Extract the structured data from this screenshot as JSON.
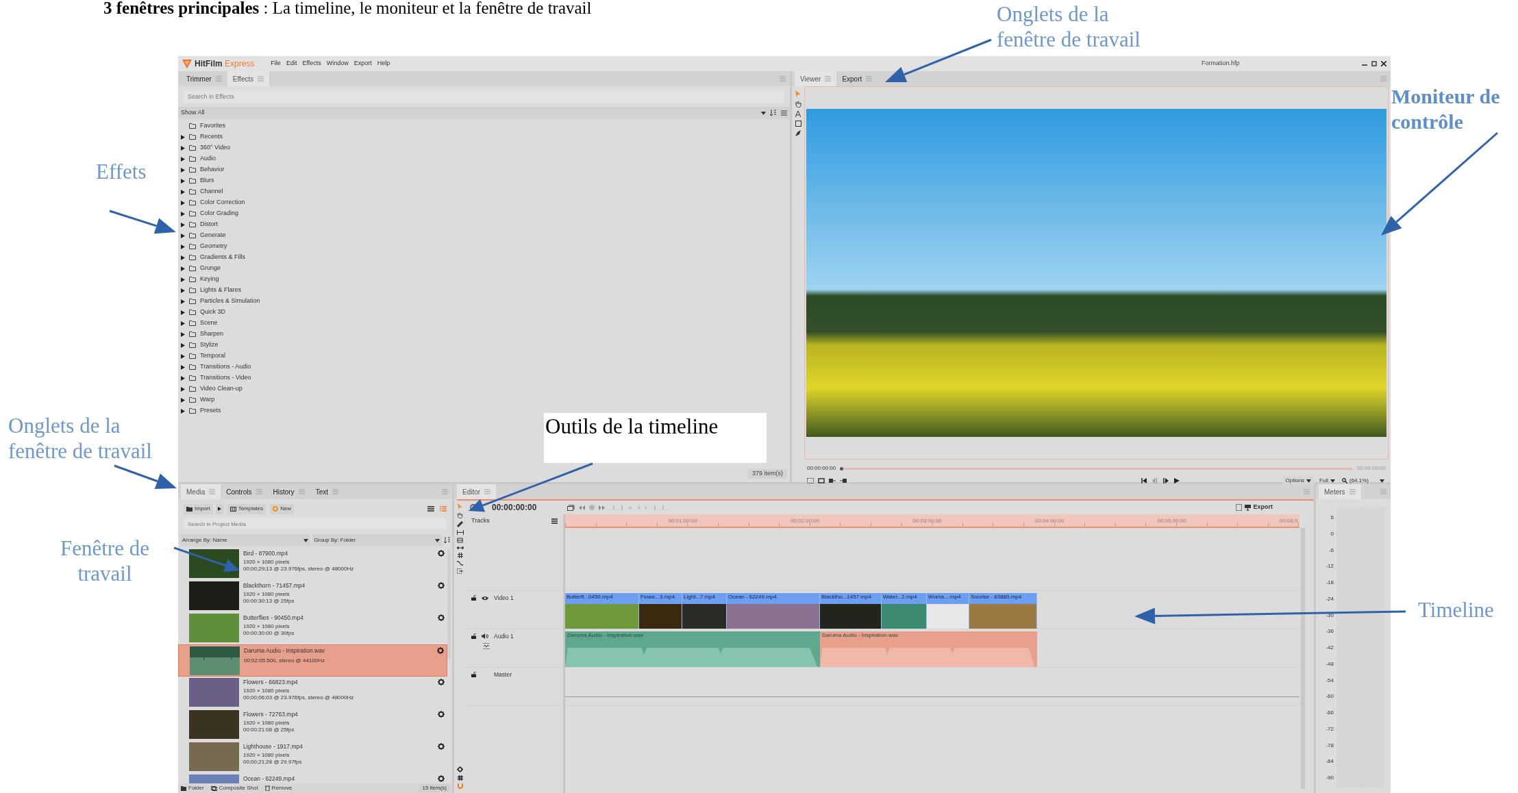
{
  "heading": "**3 fenêtres principales** : La timeline, le moniteur et la fenêtre de travail",
  "annotations": [
    {
      "kind": "plain",
      "text": "Onglets de la\nfenêtre de travail"
    },
    {
      "kind": "bold",
      "text": "Moniteur de\ncontrôle"
    },
    {
      "kind": "plain",
      "text": "Effets"
    },
    {
      "kind": "plain",
      "text": "Onglets de la\nfenêtre de travail"
    },
    {
      "kind": "boxed",
      "text": "Outils de la timeline"
    },
    {
      "kind": "plain",
      "text": "Fenêtre de\ntravail"
    },
    {
      "kind": "plain",
      "text": "Timeline"
    }
  ],
  "app": {
    "title_bar": {
      "app_name": "HitFilm",
      "edition": "Express",
      "menu": [
        "File",
        "Edit",
        "Effects",
        "Window",
        "Export",
        "Help"
      ],
      "project": "Formation.hfp"
    },
    "effects_panel": {
      "tabs": [
        {
          "label": "Trimmer",
          "selected": false
        },
        {
          "label": "Effects",
          "selected": true
        }
      ],
      "search": {
        "placeholder": "Search in Effects"
      },
      "filter": "Show All",
      "tree": [
        {
          "label": "Favorites",
          "has_children": false
        },
        {
          "label": "Recents",
          "has_children": true
        },
        {
          "label": "360° Video",
          "has_children": true
        },
        {
          "label": "Audio",
          "has_children": true
        },
        {
          "label": "Behavior",
          "has_children": true
        },
        {
          "label": "Blurs",
          "has_children": true
        },
        {
          "label": "Channel",
          "has_children": true
        },
        {
          "label": "Color Correction",
          "has_children": true
        },
        {
          "label": "Color Grading",
          "has_children": true
        },
        {
          "label": "Distort",
          "has_children": true
        },
        {
          "label": "Generate",
          "has_children": true
        },
        {
          "label": "Geometry",
          "has_children": true
        },
        {
          "label": "Gradients & Fills",
          "has_children": true
        },
        {
          "label": "Grunge",
          "has_children": true
        },
        {
          "label": "Keying",
          "has_children": true
        },
        {
          "label": "Lights & Flares",
          "has_children": true
        },
        {
          "label": "Particles & Simulation",
          "has_children": true
        },
        {
          "label": "Quick 3D",
          "has_children": true
        },
        {
          "label": "Scene",
          "has_children": true
        },
        {
          "label": "Sharpen",
          "has_children": true
        },
        {
          "label": "Stylize",
          "has_children": true
        },
        {
          "label": "Temporal",
          "has_children": true
        },
        {
          "label": "Transitions - Audio",
          "has_children": true
        },
        {
          "label": "Transitions - Video",
          "has_children": true
        },
        {
          "label": "Video Clean-up",
          "has_children": true
        },
        {
          "label": "Warp",
          "has_children": true
        },
        {
          "label": "Presets",
          "has_children": true
        }
      ],
      "count": "379 item(s)"
    },
    "viewer": {
      "tabs": [
        {
          "label": "Viewer",
          "selected": true
        },
        {
          "label": "Export",
          "selected": false
        }
      ],
      "time_start": "00:00:00:00",
      "time_end": "00:06:00:00",
      "options": "Options",
      "quality": "Full",
      "zoom": "(64.1%)"
    },
    "media_panel": {
      "tabs": [
        {
          "label": "Media",
          "selected": true
        },
        {
          "label": "Controls",
          "selected": false
        },
        {
          "label": "History",
          "selected": false
        },
        {
          "label": "Text",
          "selected": false
        }
      ],
      "buttons": [
        "Import",
        "Templates",
        "New"
      ],
      "search": {
        "placeholder": "Search in Project Media"
      },
      "arrange": "Arrange By: Name",
      "group": "Group By: Folder",
      "items": [
        {
          "kind": "video",
          "name": "Bird - 87900.mp4",
          "lines": [
            "1920 × 1080 pixels",
            "00;00;29;13 @ 23.976fps, stereo @ 48000Hz"
          ],
          "selected": false
        },
        {
          "kind": "video",
          "name": "Blackthorn - 71457.mp4",
          "lines": [
            "1920 × 1080 pixels",
            "00:00:30:13 @ 25fps"
          ],
          "selected": false
        },
        {
          "kind": "video",
          "name": "Butterflies - 90450.mp4",
          "lines": [
            "1920 × 1080 pixels",
            "00:00:30:00 @ 30fps"
          ],
          "selected": false
        },
        {
          "kind": "audio",
          "name": "Daruma Audio - Inspiration.wav",
          "lines": [
            "00:02:05.500, stereo @ 44100Hz"
          ],
          "selected": true
        },
        {
          "kind": "video",
          "name": "Flowers - 66823.mp4",
          "lines": [
            "1920 × 1080 pixels",
            "00;00;06;03 @ 23.976fps, stereo @ 48000Hz"
          ],
          "selected": false
        },
        {
          "kind": "video",
          "name": "Flowers - 72763.mp4",
          "lines": [
            "1920 × 1080 pixels",
            "00:00:21:08 @ 25fps"
          ],
          "selected": false
        },
        {
          "kind": "video",
          "name": "Lighthouse - 1917.mp4",
          "lines": [
            "1920 × 1080 pixels",
            "00;00;21;28 @ 29.97fps"
          ],
          "selected": false
        },
        {
          "kind": "video",
          "name": "Ocean - 62249.mp4",
          "selected": false
        }
      ],
      "footer": [
        "Folder",
        "Composite Shot",
        "Remove"
      ],
      "count": "15 item(s)"
    },
    "editor": {
      "tabs": [
        {
          "label": "Editor",
          "selected": true
        }
      ],
      "timecode": "00:00:00:00",
      "export": "Export",
      "tracks_header": "Tracks",
      "ruler": [
        "00:01:00:00",
        "00:02:00:00",
        "00:03:00:00",
        "00:04:00:00",
        "00:05:00:00",
        "00:06:0"
      ],
      "tracks": [
        {
          "kind": "video",
          "name": "Video 1",
          "clips": [
            {
              "label": "Butterfl...0450.mp4"
            },
            {
              "label": "Flowe...3.mp4"
            },
            {
              "label": "Light...7.mp4"
            },
            {
              "label": "Ocean - 62249.mp4"
            },
            {
              "label": "Blacktho...1457.mp4"
            },
            {
              "label": "Water...2.mp4"
            },
            {
              "label": "Woma....mp4"
            },
            {
              "label": "Sunrise - 83880.mp4"
            }
          ]
        },
        {
          "kind": "audio",
          "name": "Audio 1",
          "clips": [
            {
              "label": "Daruma Audio - Inspiration.wav",
              "selected": false
            },
            {
              "label": "Daruma Audio - Inspiration.wav",
              "selected": true
            }
          ]
        },
        {
          "kind": "master",
          "name": "Master"
        }
      ]
    },
    "meters": {
      "tabs": [
        {
          "label": "Meters",
          "selected": true
        }
      ],
      "scale": [
        "6",
        "0",
        "-6",
        "-12",
        "-18",
        "-24",
        "-30",
        "-36",
        "-42",
        "-48",
        "-54",
        "-60",
        "-66",
        "-72",
        "-78",
        "-84",
        "-90"
      ]
    }
  }
}
